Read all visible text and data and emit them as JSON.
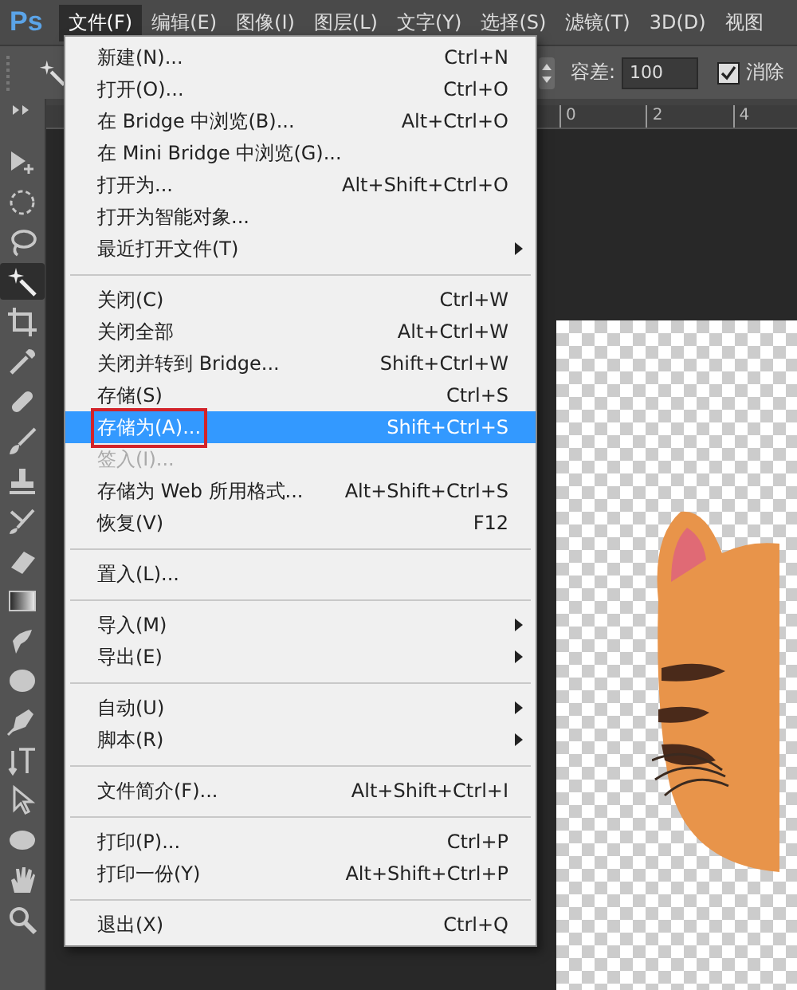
{
  "menubar": {
    "logo": "Ps",
    "items": [
      {
        "label": "文件(F)",
        "selected": true
      },
      {
        "label": "编辑(E)",
        "selected": false
      },
      {
        "label": "图像(I)",
        "selected": false
      },
      {
        "label": "图层(L)",
        "selected": false
      },
      {
        "label": "文字(Y)",
        "selected": false
      },
      {
        "label": "选择(S)",
        "selected": false
      },
      {
        "label": "滤镜(T)",
        "selected": false
      },
      {
        "label": "3D(D)",
        "selected": false
      },
      {
        "label": "视图",
        "selected": false
      }
    ]
  },
  "options_bar": {
    "tolerance_label": "容差:",
    "tolerance_value": "100",
    "anti_alias": {
      "label": "消除",
      "checked": true
    }
  },
  "tools": [
    {
      "kind": "move",
      "selected": false
    },
    {
      "kind": "marquee",
      "selected": false
    },
    {
      "kind": "lasso",
      "selected": false
    },
    {
      "kind": "wand",
      "selected": true
    },
    {
      "kind": "crop",
      "selected": false
    },
    {
      "kind": "eyedropper",
      "selected": false
    },
    {
      "kind": "bandage",
      "selected": false
    },
    {
      "kind": "brush",
      "selected": false
    },
    {
      "kind": "stamp",
      "selected": false
    },
    {
      "kind": "history",
      "selected": false
    },
    {
      "kind": "eraser",
      "selected": false
    },
    {
      "kind": "gradient",
      "selected": false
    },
    {
      "kind": "drop",
      "selected": false
    },
    {
      "kind": "sponge",
      "selected": false
    },
    {
      "kind": "pen",
      "selected": false
    },
    {
      "kind": "type",
      "selected": false
    },
    {
      "kind": "arrow",
      "selected": false
    },
    {
      "kind": "ellipse",
      "selected": false
    },
    {
      "kind": "hand",
      "selected": false
    },
    {
      "kind": "zoom",
      "selected": false
    }
  ],
  "ruler": {
    "labels": [
      "0",
      "2",
      "4"
    ]
  },
  "file_menu": {
    "groups": [
      {
        "items": [
          {
            "label": "新建(N)...",
            "shortcut": "Ctrl+N",
            "submenu": false,
            "selected": false,
            "disabled": false
          },
          {
            "label": "打开(O)...",
            "shortcut": "Ctrl+O",
            "submenu": false,
            "selected": false,
            "disabled": false
          },
          {
            "label": "在 Bridge 中浏览(B)...",
            "shortcut": "Alt+Ctrl+O",
            "submenu": false,
            "selected": false,
            "disabled": false
          },
          {
            "label": "在 Mini Bridge 中浏览(G)...",
            "submenu": false,
            "selected": false,
            "disabled": false
          },
          {
            "label": "打开为...",
            "shortcut": "Alt+Shift+Ctrl+O",
            "submenu": false,
            "selected": false,
            "disabled": false
          },
          {
            "label": "打开为智能对象...",
            "submenu": false,
            "selected": false,
            "disabled": false
          },
          {
            "label": "最近打开文件(T)",
            "submenu": true,
            "selected": false,
            "disabled": false
          }
        ]
      },
      {
        "items": [
          {
            "label": "关闭(C)",
            "shortcut": "Ctrl+W",
            "submenu": false,
            "selected": false,
            "disabled": false
          },
          {
            "label": "关闭全部",
            "shortcut": "Alt+Ctrl+W",
            "submenu": false,
            "selected": false,
            "disabled": false
          },
          {
            "label": "关闭并转到 Bridge...",
            "shortcut": "Shift+Ctrl+W",
            "submenu": false,
            "selected": false,
            "disabled": false
          },
          {
            "label": "存储(S)",
            "shortcut": "Ctrl+S",
            "submenu": false,
            "selected": false,
            "disabled": false
          },
          {
            "label": "存储为(A)...",
            "shortcut": "Shift+Ctrl+S",
            "submenu": false,
            "selected": true,
            "disabled": false,
            "annotated": true
          },
          {
            "label": "签入(I)...",
            "submenu": false,
            "selected": false,
            "disabled": true
          },
          {
            "label": "存储为 Web 所用格式...",
            "shortcut": "Alt+Shift+Ctrl+S",
            "submenu": false,
            "selected": false,
            "disabled": false
          },
          {
            "label": "恢复(V)",
            "shortcut": "F12",
            "submenu": false,
            "selected": false,
            "disabled": false
          }
        ]
      },
      {
        "items": [
          {
            "label": "置入(L)...",
            "submenu": false,
            "selected": false,
            "disabled": false
          }
        ]
      },
      {
        "items": [
          {
            "label": "导入(M)",
            "submenu": true,
            "selected": false,
            "disabled": false
          },
          {
            "label": "导出(E)",
            "submenu": true,
            "selected": false,
            "disabled": false
          }
        ]
      },
      {
        "items": [
          {
            "label": "自动(U)",
            "submenu": true,
            "selected": false,
            "disabled": false
          },
          {
            "label": "脚本(R)",
            "submenu": true,
            "selected": false,
            "disabled": false
          }
        ]
      },
      {
        "items": [
          {
            "label": "文件简介(F)...",
            "shortcut": "Alt+Shift+Ctrl+I",
            "submenu": false,
            "selected": false,
            "disabled": false
          }
        ]
      },
      {
        "items": [
          {
            "label": "打印(P)...",
            "shortcut": "Ctrl+P",
            "submenu": false,
            "selected": false,
            "disabled": false
          },
          {
            "label": "打印一份(Y)",
            "shortcut": "Alt+Shift+Ctrl+P",
            "submenu": false,
            "selected": false,
            "disabled": false
          }
        ]
      },
      {
        "items": [
          {
            "label": "退出(X)",
            "shortcut": "Ctrl+Q",
            "submenu": false,
            "selected": false,
            "disabled": false
          }
        ]
      }
    ]
  }
}
